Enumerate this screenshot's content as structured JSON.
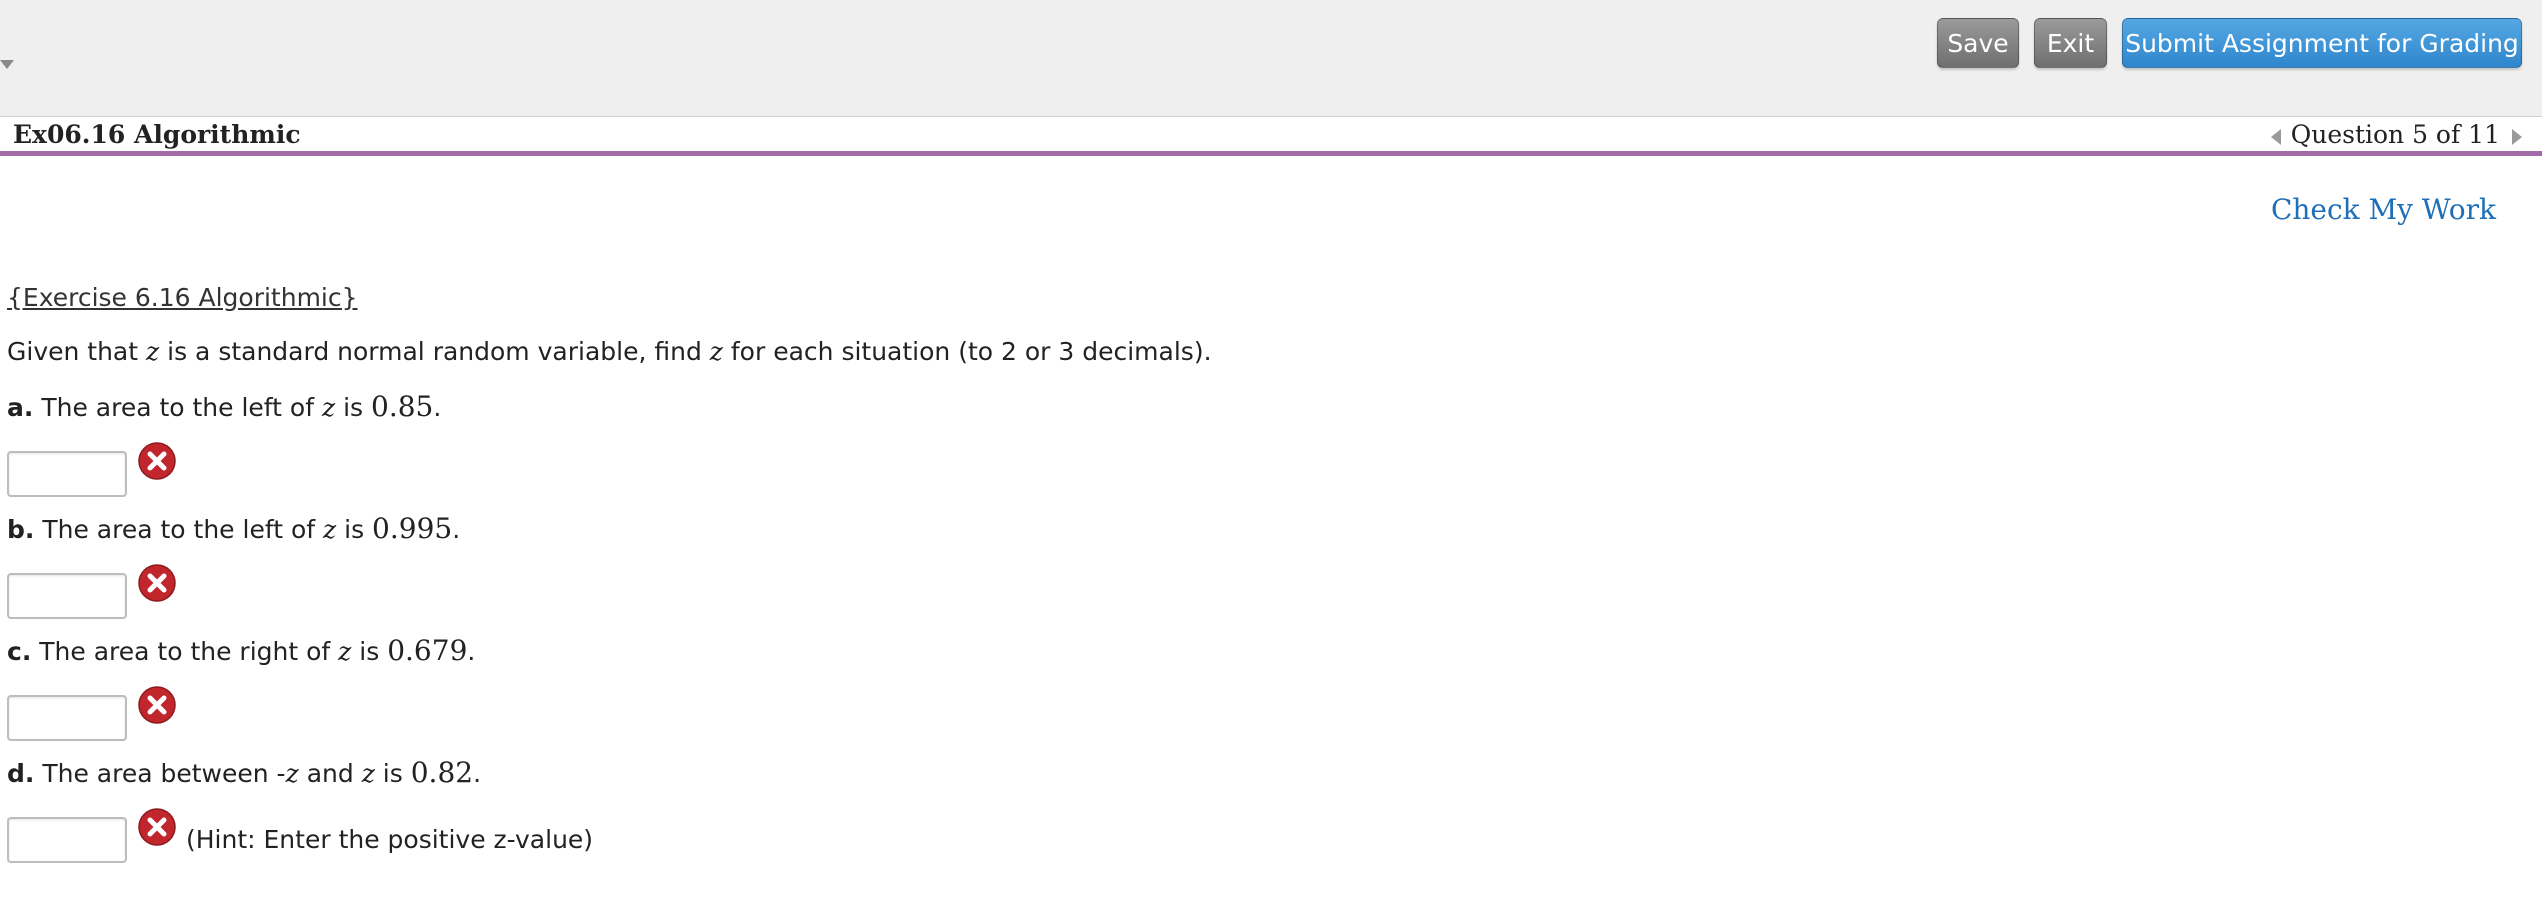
{
  "toolbar": {
    "save_label": "Save",
    "exit_label": "Exit",
    "submit_label": "Submit Assignment for Grading"
  },
  "header": {
    "title": "Ex06.16 Algorithmic",
    "question_nav": "Question 5 of 11"
  },
  "main": {
    "check_my_work": "Check My Work",
    "exercise_title": "{Exercise 6.16 Algorithmic}",
    "intro_before": "Given that ",
    "intro_var": "z",
    "intro_middle": " is a standard normal random variable, find ",
    "intro_var2": "z",
    "intro_after": " for each situation (to 2 or 3 decimals).",
    "parts": [
      {
        "letter": "a.",
        "text_before": " The area to the left of ",
        "var": "z",
        "text_is": " is ",
        "value": "0.85",
        "end": ".",
        "answer": "",
        "hint": ""
      },
      {
        "letter": "b.",
        "text_before": " The area to the left of ",
        "var": "z",
        "text_is": " is ",
        "value": "0.995",
        "end": ".",
        "answer": "",
        "hint": ""
      },
      {
        "letter": "c.",
        "text_before": " The area to the right of ",
        "var": "z",
        "text_is": " is ",
        "value": "0.679",
        "end": ".",
        "answer": "",
        "hint": ""
      },
      {
        "letter": "d.",
        "text_before": " The area between -",
        "var_neg": "z",
        "text_and": " and ",
        "var": "z",
        "text_is": " is ",
        "value": "0.82",
        "end": ".",
        "answer": "",
        "hint": "(Hint: Enter the positive z-value)"
      }
    ]
  },
  "colors": {
    "accent_blue": "#2f86cc",
    "gray_button": "#7f7f7f",
    "title_rule": "#a36aa8",
    "link_blue": "#1e6fb8",
    "error_red": "#c0262c"
  },
  "icons": {
    "collapse": "chevron-down-icon",
    "prev": "chevron-left-icon",
    "next": "chevron-right-icon",
    "incorrect": "close-circle-icon"
  }
}
